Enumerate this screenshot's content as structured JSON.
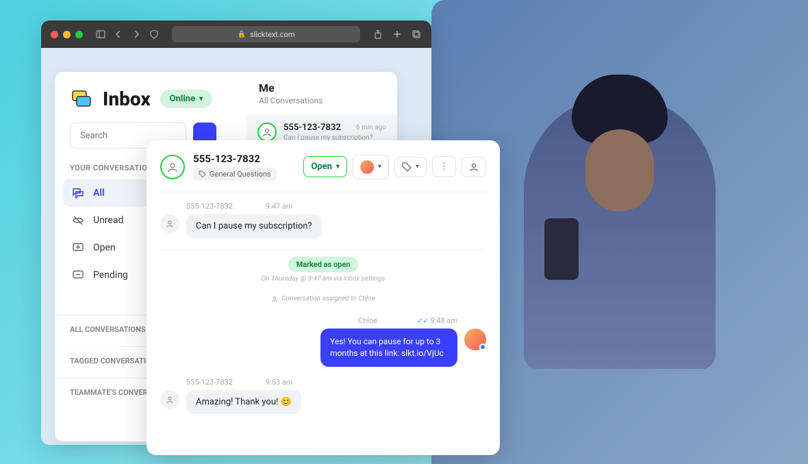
{
  "browser": {
    "url": "slicktext.com"
  },
  "inbox": {
    "title": "Inbox",
    "status": "Online",
    "search_placeholder": "Search",
    "me_header": {
      "title": "Me",
      "subtitle": "All Conversations"
    },
    "convo_row": {
      "number": "555-123-7832",
      "preview": "Can I pause my subscription?",
      "time": "6 min ago"
    },
    "sections": {
      "your": "YOUR CONVERSATIONS",
      "all": "ALL CONVERSATIONS",
      "tagged": "TAGGED CONVERSATIONS",
      "teammate": "TEAMMATE'S CONVERSATIONS"
    },
    "filters": {
      "all": "All",
      "unread": "Unread",
      "open": "Open",
      "pending": "Pending"
    }
  },
  "chat": {
    "number": "555-123-7832",
    "tag": "General Questions",
    "open_label": "Open",
    "msg1": {
      "from": "555-123-7832",
      "time": "9:47 am",
      "text": "Can I pause my subscription?"
    },
    "marked": "Marked as open",
    "meta_time": "On Thursday @ 9:47 am via inbox settings",
    "assigned": "Conversation assigned to Chloe",
    "msg2": {
      "from": "Chloe",
      "time": "9:48 am",
      "text": "Yes! You can pause for up to 3 months at this link: slkt.io/VjUc"
    },
    "msg3": {
      "from": "555-123-7832",
      "time": "9:53 am",
      "text": "Amazing! Thank you! 😊"
    }
  }
}
